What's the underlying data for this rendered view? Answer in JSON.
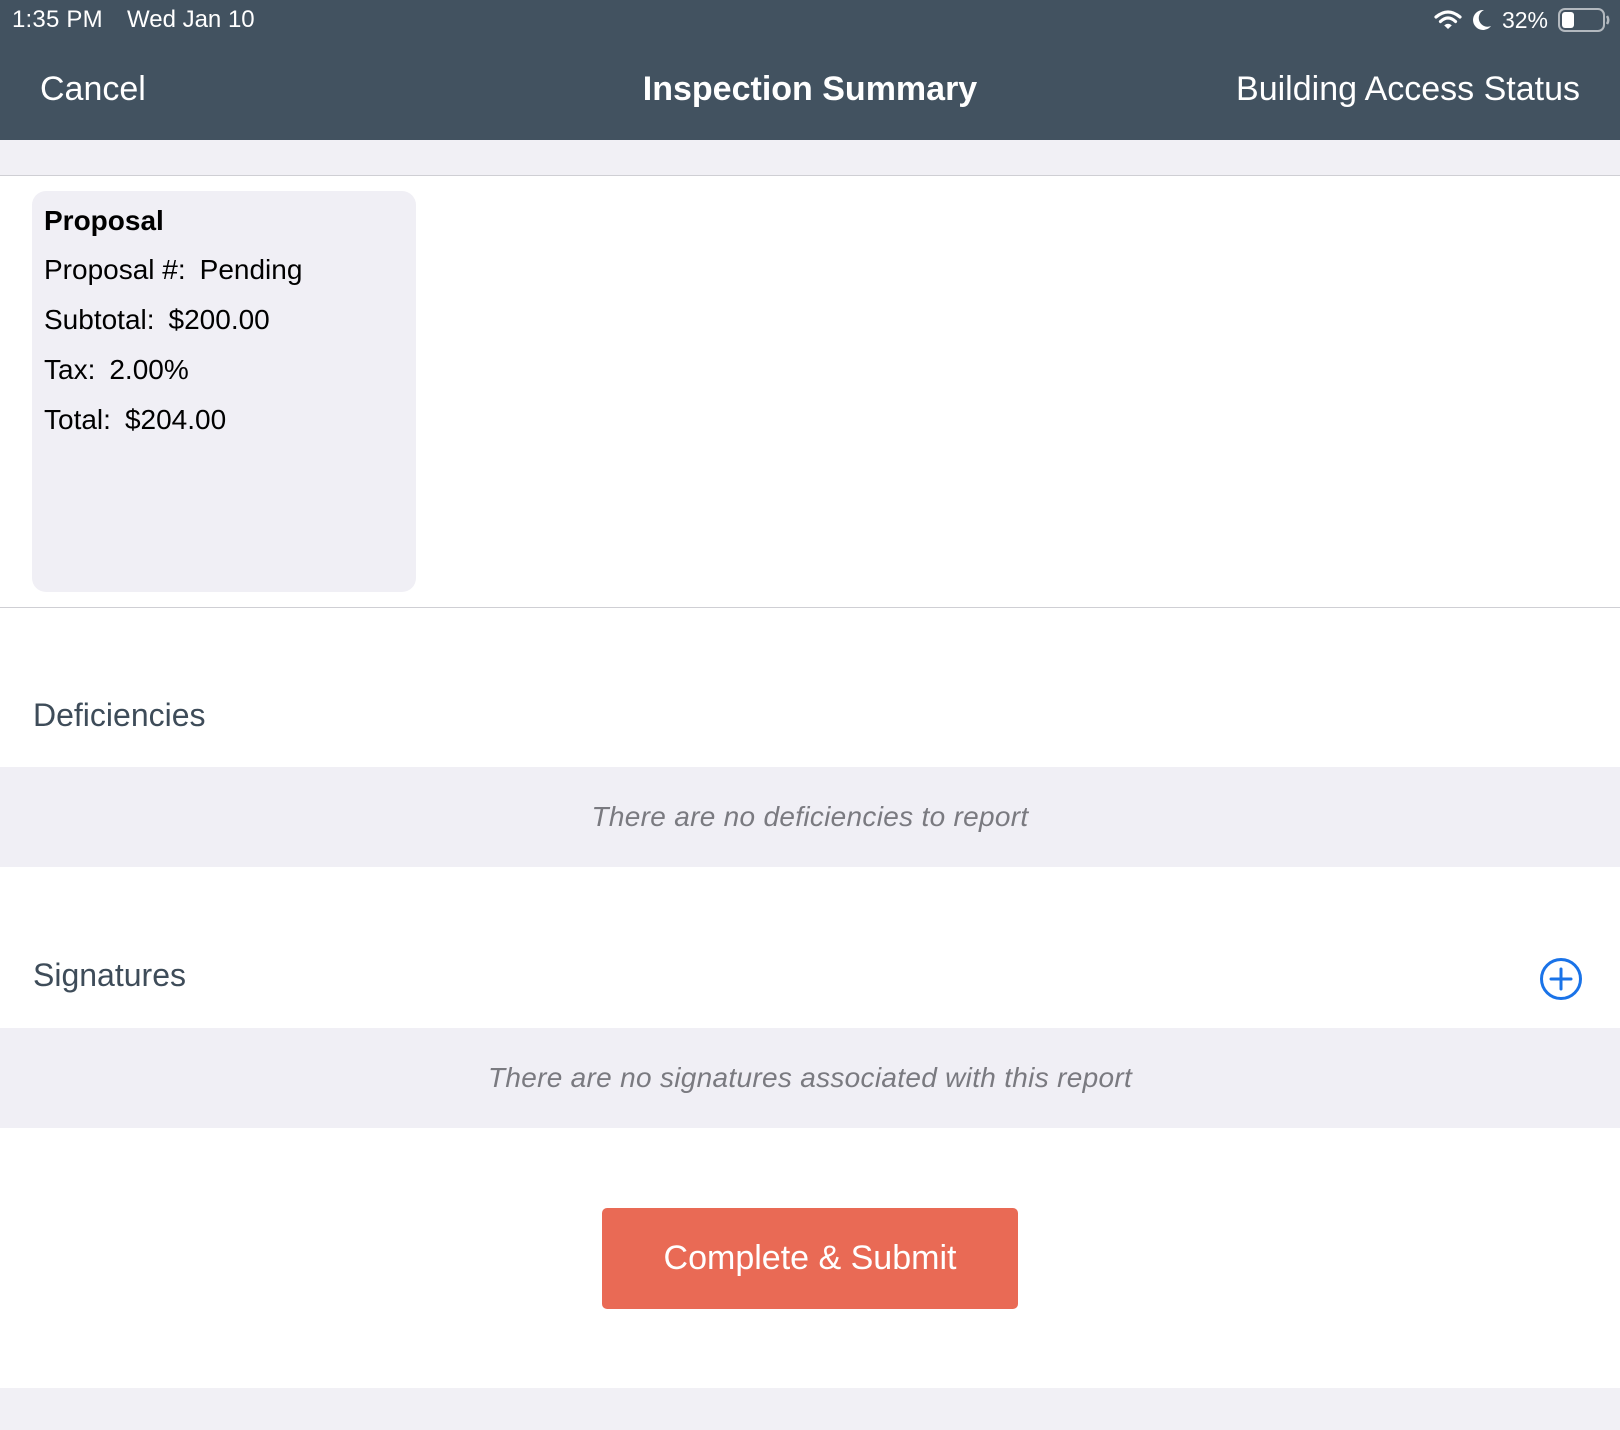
{
  "status_bar": {
    "time": "1:35 PM",
    "date": "Wed Jan 10",
    "battery_percent": "32%",
    "battery_level": 0.32,
    "icons": [
      "wifi-icon",
      "moon-icon",
      "battery-icon"
    ]
  },
  "nav": {
    "cancel_label": "Cancel",
    "title": "Inspection Summary",
    "right_label": "Building Access Status"
  },
  "proposal": {
    "title": "Proposal",
    "rows": [
      {
        "label": "Proposal #:",
        "value": "Pending"
      },
      {
        "label": "Subtotal:",
        "value": "$200.00"
      },
      {
        "label": "Tax:",
        "value": "2.00%"
      },
      {
        "label": "Total:",
        "value": "$204.00"
      }
    ]
  },
  "deficiencies": {
    "title": "Deficiencies",
    "empty_text": "There are no deficiencies to report"
  },
  "signatures": {
    "title": "Signatures",
    "empty_text": "There are no signatures associated with this report",
    "add_icon": "plus-circle-icon"
  },
  "actions": {
    "submit_label": "Complete & Submit"
  },
  "colors": {
    "header_bg": "#425260",
    "accent_blue": "#1a73e8",
    "submit_bg": "#e96a55",
    "band_bg": "#f0eff5"
  }
}
